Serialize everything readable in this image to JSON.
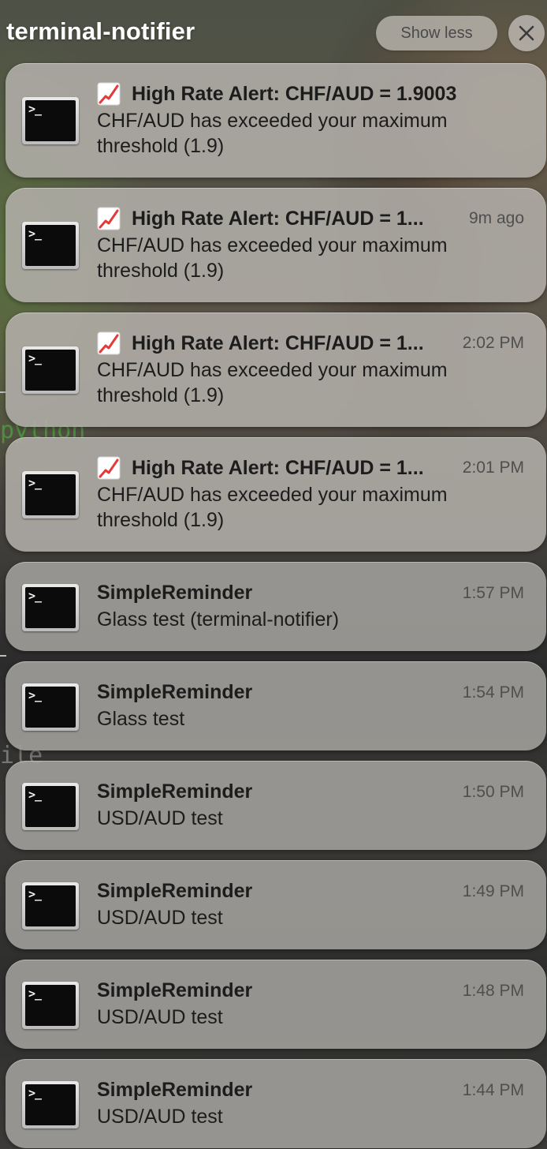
{
  "group": {
    "title": "terminal-notifier",
    "show_less_label": "Show less"
  },
  "notifications": [
    {
      "title": "High Rate Alert: CHF/AUD = 1.9003",
      "time": "",
      "body": "CHF/AUD has exceeded your maximum threshold (1.9)",
      "icon": "terminal-icon",
      "emoji": "chart-increasing-icon"
    },
    {
      "title": "High Rate Alert: CHF/AUD = 1...",
      "time": "9m ago",
      "body": "CHF/AUD has exceeded your maximum threshold (1.9)",
      "icon": "terminal-icon",
      "emoji": "chart-increasing-icon"
    },
    {
      "title": "High Rate Alert: CHF/AUD = 1...",
      "time": "2:02 PM",
      "body": "CHF/AUD has exceeded your maximum threshold (1.9)",
      "icon": "terminal-icon",
      "emoji": "chart-increasing-icon"
    },
    {
      "title": "High Rate Alert: CHF/AUD = 1...",
      "time": "2:01 PM",
      "body": "CHF/AUD has exceeded your maximum threshold (1.9)",
      "icon": "terminal-icon",
      "emoji": "chart-increasing-icon"
    },
    {
      "title": "SimpleReminder",
      "time": "1:57 PM",
      "body": "Glass test (terminal-notifier)",
      "icon": "terminal-icon"
    },
    {
      "title": "SimpleReminder",
      "time": "1:54 PM",
      "body": "Glass test",
      "icon": "terminal-icon"
    },
    {
      "title": "SimpleReminder",
      "time": "1:50 PM",
      "body": "USD/AUD test",
      "icon": "terminal-icon"
    },
    {
      "title": "SimpleReminder",
      "time": "1:49 PM",
      "body": "USD/AUD test",
      "icon": "terminal-icon"
    },
    {
      "title": "SimpleReminder",
      "time": "1:48 PM",
      "body": "USD/AUD test",
      "icon": "terminal-icon"
    },
    {
      "title": "SimpleReminder",
      "time": "1:44 PM",
      "body": "USD/AUD test",
      "icon": "terminal-icon"
    }
  ],
  "colors": {
    "card_background": "#b2aea8",
    "title_text": "#1c1c1c",
    "time_text": "#4f4f4f",
    "emoji_red": "#e23b3b"
  }
}
